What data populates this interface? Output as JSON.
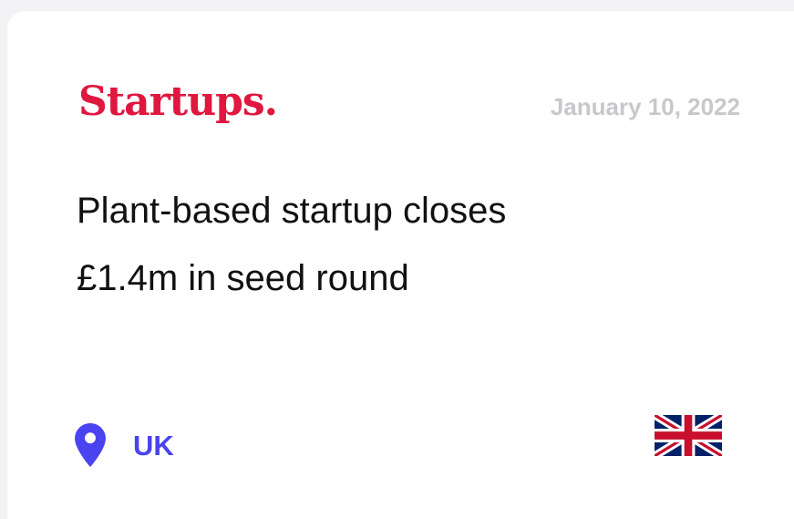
{
  "card": {
    "publisher": "Startups.",
    "date": "January 10, 2022",
    "headline_line1": "Plant-based startup closes",
    "headline_line2": "£1.4m in seed round",
    "location_label": "UK",
    "location_icon": "map-pin-icon",
    "flag_icon": "uk-flag-icon",
    "colors": {
      "brand": "#e0173f",
      "accent": "#4a43f0",
      "muted": "#c8c8cc",
      "text": "#111111",
      "background": "#ffffff"
    }
  }
}
